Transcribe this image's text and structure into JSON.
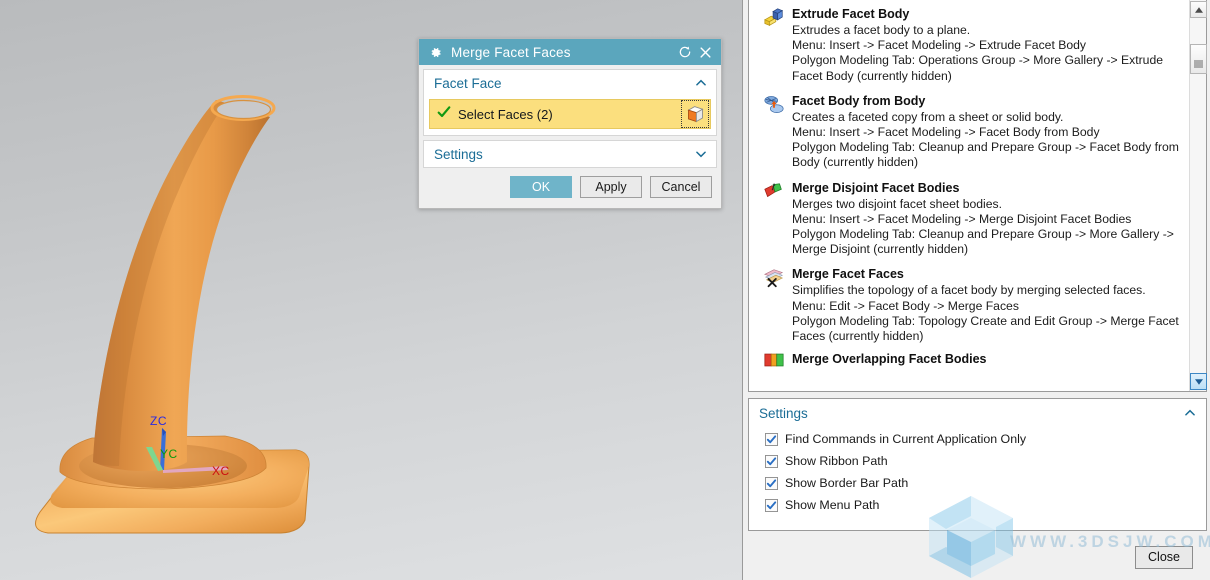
{
  "viewport": {
    "name": "3d-model-viewport",
    "model": "traffic-cone",
    "axes": [
      {
        "label": "ZC",
        "color": "#2a2ae0"
      },
      {
        "label": "YC",
        "color": "#0c9a0c"
      },
      {
        "label": "XC",
        "color": "#cc1111"
      }
    ]
  },
  "dialog": {
    "title": "Merge Facet Faces",
    "title_bar": {
      "gear_icon": "gear-icon",
      "reset_icon": "reset-icon",
      "close_icon": "close-icon"
    },
    "groups": [
      {
        "label": "Facet Face",
        "expanded": true,
        "chevron": "chevron-up-icon",
        "selection": {
          "label": "Select Faces (2)",
          "count": 2,
          "checkmark": "green-check-icon",
          "select_button_icon": "select-body-cube-icon",
          "highlight_color": "#fbdf7e"
        }
      },
      {
        "label": "Settings",
        "expanded": false,
        "chevron": "chevron-down-icon"
      }
    ],
    "buttons": {
      "ok": "OK",
      "apply": "Apply",
      "cancel": "Cancel",
      "ok_color": "#6fb4c9"
    }
  },
  "command_finder": {
    "commands": [
      {
        "icon": "extrude-facet-body-icon",
        "name": "Extrude Facet Body",
        "description": "Extrudes a facet body to a plane.",
        "menu_path": "Menu: Insert -> Facet Modeling -> Extrude Facet Body",
        "ribbon_path": "Polygon Modeling Tab: Operations Group -> More Gallery -> Extrude Facet Body (currently hidden)"
      },
      {
        "icon": "facet-body-from-body-icon",
        "name": "Facet Body from Body",
        "description": "Creates a faceted copy from a sheet or solid body.",
        "menu_path": "Menu: Insert -> Facet Modeling -> Facet Body from Body",
        "ribbon_path": "Polygon Modeling Tab: Cleanup and Prepare Group -> Facet Body from Body (currently hidden)"
      },
      {
        "icon": "merge-disjoint-facet-bodies-icon",
        "name": "Merge Disjoint Facet Bodies",
        "description": "Merges two disjoint facet sheet bodies.",
        "menu_path": "Menu: Insert -> Facet Modeling -> Merge Disjoint Facet Bodies",
        "ribbon_path": "Polygon Modeling Tab: Cleanup and Prepare Group -> More Gallery -> Merge Disjoint (currently hidden)"
      },
      {
        "icon": "merge-facet-faces-icon",
        "name": "Merge Facet Faces",
        "description": "Simplifies the topology of a facet body by merging selected faces.",
        "menu_path": "Menu: Edit -> Facet Body -> Merge Faces",
        "ribbon_path": "Polygon Modeling Tab: Topology Create and Edit Group -> Merge Facet Faces (currently hidden)"
      },
      {
        "icon": "merge-overlapping-facet-bodies-icon",
        "name": "Merge Overlapping Facet Bodies",
        "description": "",
        "menu_path": "",
        "ribbon_path": ""
      }
    ],
    "scrollbar": {
      "up_arrow": "scroll-up-arrow-icon",
      "down_arrow": "scroll-down-arrow-icon",
      "thumb": "scroll-thumb"
    }
  },
  "settings": {
    "title": "Settings",
    "chevron": "chevron-up-icon",
    "options": [
      {
        "label": "Find Commands in Current Application Only",
        "checked": true
      },
      {
        "label": "Show Ribbon Path",
        "checked": true
      },
      {
        "label": "Show Border Bar Path",
        "checked": true
      },
      {
        "label": "Show Menu Path",
        "checked": true
      }
    ]
  },
  "footer": {
    "close_button": "Close"
  },
  "watermark": {
    "text": "WWW.3DSJW.COM",
    "logo": "hex-cube-logo"
  }
}
